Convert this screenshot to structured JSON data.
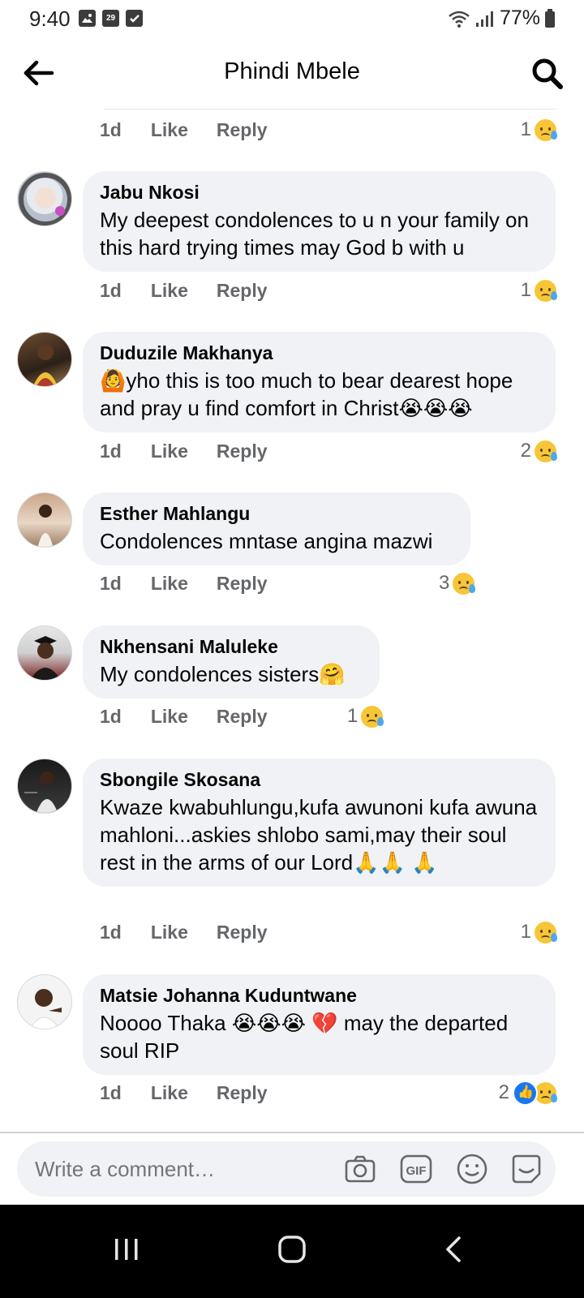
{
  "status_bar": {
    "time": "9:40",
    "calendar_day": "29",
    "battery": "77%"
  },
  "header": {
    "title": "Phindi Mbele",
    "back_icon": "arrow-left-icon",
    "search_icon": "search-icon"
  },
  "first_meta": {
    "time": "1d",
    "like": "Like",
    "reply": "Reply",
    "reaction_count": "1"
  },
  "comments": [
    {
      "author": "Jabu Nkosi",
      "text": "My deepest condolences to u n your family on this hard trying times may God b with u",
      "time": "1d",
      "like": "Like",
      "reply": "Reply",
      "reaction_count": "1"
    },
    {
      "author": "Duduzile Makhanya",
      "text": "🙆yho this is too much to bear dearest hope and pray u find comfort in Christ😭😭😭",
      "time": "1d",
      "like": "Like",
      "reply": "Reply",
      "reaction_count": "2"
    },
    {
      "author": "Esther Mahlangu",
      "text": "Condolences mntase angina mazwi",
      "time": "1d",
      "like": "Like",
      "reply": "Reply",
      "reaction_count": "3"
    },
    {
      "author": "Nkhensani Maluleke",
      "text": "My condolences sisters🤗",
      "time": "1d",
      "like": "Like",
      "reply": "Reply",
      "reaction_count": "1"
    },
    {
      "author": "Sbongile Skosana",
      "text": "Kwaze kwabuhlungu,kufa awunoni kufa awuna mahloni...askies shlobo sami,may their soul rest in the arms of our Lord🙏🙏 🙏",
      "time": "1d",
      "like": "Like",
      "reply": "Reply",
      "reaction_count": "1"
    },
    {
      "author": "Matsie Johanna Kuduntwane",
      "text": "Noooo Thaka 😭😭😭 💔 may the departed soul RIP",
      "time": "1d",
      "like": "Like",
      "reply": "Reply",
      "reaction_count": "2"
    }
  ],
  "composer": {
    "placeholder": "Write a comment…"
  },
  "colors": {
    "bubble": "#f0f2f5",
    "meta_text": "#65676b",
    "like_blue": "#1877f2",
    "sad_yellow": "#f7c638"
  }
}
